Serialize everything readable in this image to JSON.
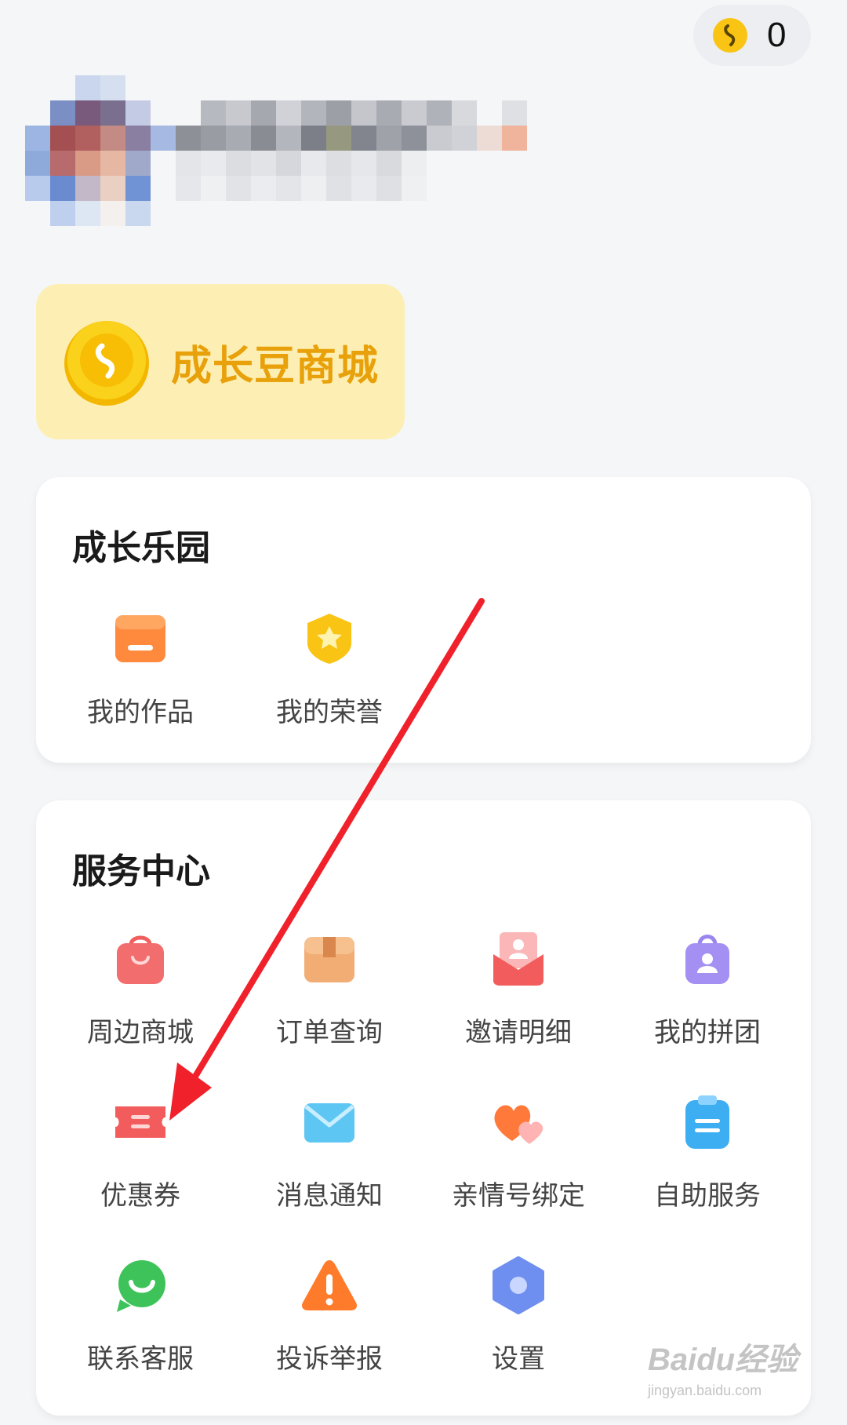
{
  "header": {
    "coin_count": "0"
  },
  "mall": {
    "label": "成长豆商城"
  },
  "growth_park": {
    "title": "成长乐园",
    "items": [
      {
        "label": "我的作品",
        "icon": "works-icon"
      },
      {
        "label": "我的荣誉",
        "icon": "honor-icon"
      }
    ]
  },
  "service_center": {
    "title": "服务中心",
    "items": [
      {
        "label": "周边商城",
        "icon": "shopping-bag-icon"
      },
      {
        "label": "订单查询",
        "icon": "package-icon"
      },
      {
        "label": "邀请明细",
        "icon": "invite-envelope-icon"
      },
      {
        "label": "我的拼团",
        "icon": "group-bag-icon"
      },
      {
        "label": "优惠券",
        "icon": "coupon-icon"
      },
      {
        "label": "消息通知",
        "icon": "mail-icon"
      },
      {
        "label": "亲情号绑定",
        "icon": "hearts-icon"
      },
      {
        "label": "自助服务",
        "icon": "clipboard-icon"
      },
      {
        "label": "联系客服",
        "icon": "chat-bubble-icon"
      },
      {
        "label": "投诉举报",
        "icon": "warning-icon"
      },
      {
        "label": "设置",
        "icon": "settings-hexagon-icon"
      }
    ]
  },
  "watermark": {
    "main": "Baidu经验",
    "url": "jingyan.baidu.com"
  },
  "colors": {
    "background": "#f5f6f8",
    "mall_bg": "#fdefb3",
    "mall_text": "#e8a10a",
    "arrow": "#f0212a"
  }
}
